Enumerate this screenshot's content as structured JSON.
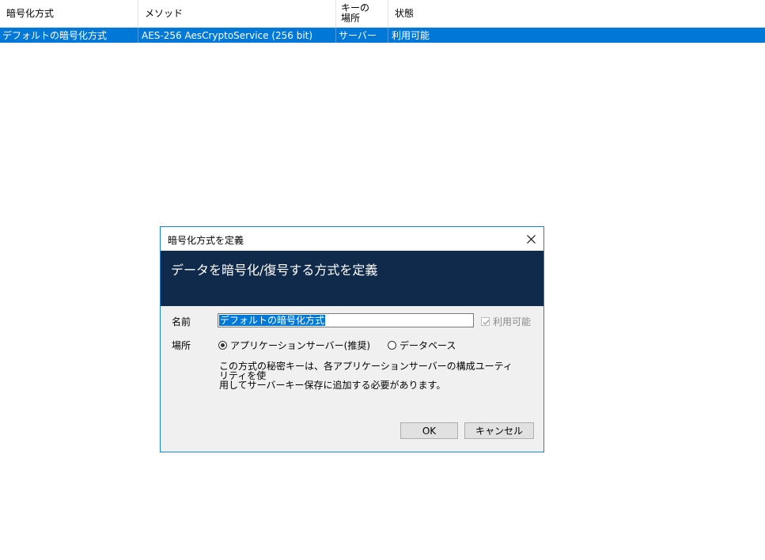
{
  "table": {
    "columns": [
      "暗号化方式",
      "メソッド",
      "キーの\n場所",
      "状態"
    ],
    "rows": [
      {
        "name": "デフォルトの暗号化方式",
        "method": "AES-256 AesCryptoService (256 bit)",
        "location": "サーバー",
        "status": "利用可能"
      }
    ]
  },
  "dialog": {
    "title": "暗号化方式を定義",
    "banner": "データを暗号化/復号する方式を定義",
    "name_label": "名前",
    "name_value": "デフォルトの暗号化方式",
    "enabled_label": "利用可能",
    "enabled_checked": true,
    "location_label": "場所",
    "option_app_server": "アプリケーションサーバー(推奨)",
    "option_database": "データベース",
    "selected_option": "app_server",
    "note_line1": "この方式の秘密キーは、各アプリケーションサーバーの構成ユーティリティを使",
    "note_line2": "用してサーバーキー保存に追加する必要があります。",
    "ok_label": "OK",
    "cancel_label": "キャンセル"
  },
  "colors": {
    "selection": "#0078d7",
    "banner": "#0f2a4a",
    "dialog_border": "#1883d7"
  }
}
